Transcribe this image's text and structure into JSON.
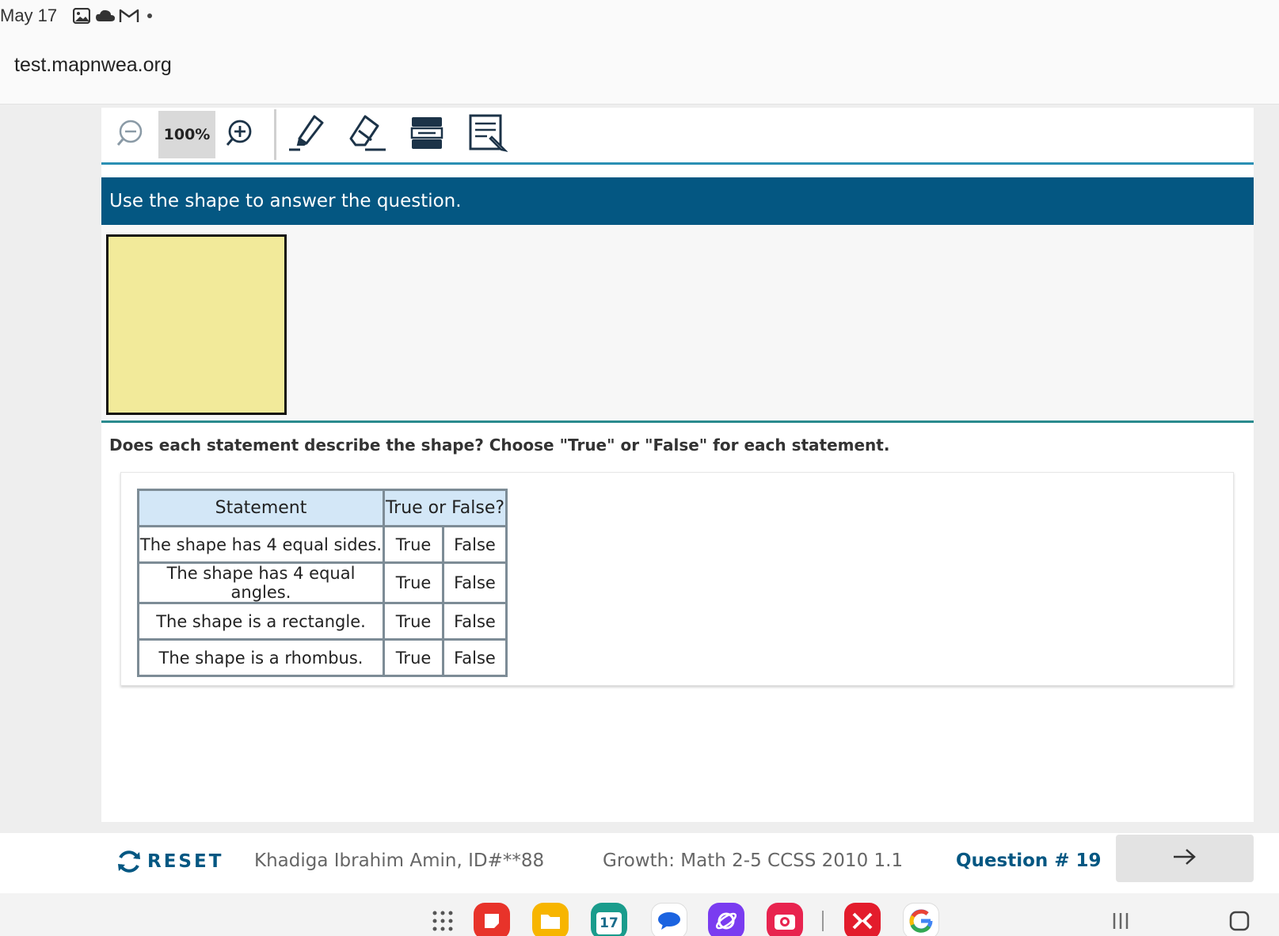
{
  "status_bar": {
    "date": "May 17",
    "icons": [
      "gallery-icon",
      "cloud-icon",
      "gmail-icon",
      "notification-dot"
    ]
  },
  "browser": {
    "url": "test.mapnwea.org"
  },
  "toolbar": {
    "zoom_level": "100%",
    "tools": [
      "zoom-out-icon",
      "zoom-in-icon",
      "highlighter-icon",
      "eraser-icon",
      "line-reader-icon",
      "notepad-icon"
    ]
  },
  "question": {
    "instruction": "Use the shape to answer the question.",
    "shape_color": "#f2ea9a",
    "prompt": "Does each statement describe the shape? Choose \"True\" or \"False\" for each statement.",
    "table": {
      "headers": [
        "Statement",
        "True or False?"
      ],
      "true_label": "True",
      "false_label": "False",
      "rows": [
        "The shape has 4 equal sides.",
        "The shape has 4 equal angles.",
        "The shape is a rectangle.",
        "The shape is a rhombus."
      ]
    }
  },
  "footer": {
    "reset_label": "RESET",
    "student": "Khadiga Ibrahim Amin, ID#**88",
    "test_name": "Growth: Math 2-5 CCSS 2010 1.1",
    "question_number": "Question # 19",
    "accent_color": "#045782"
  },
  "nav_bar": {
    "calendar_day": "17",
    "apps": [
      "app-drawer-icon",
      "notes-app-icon",
      "files-app-icon",
      "calendar-app-icon",
      "messages-app-icon",
      "internet-app-icon",
      "camera-app-icon",
      "x-app-icon",
      "google-app-icon",
      "recents-icon",
      "home-icon"
    ]
  }
}
